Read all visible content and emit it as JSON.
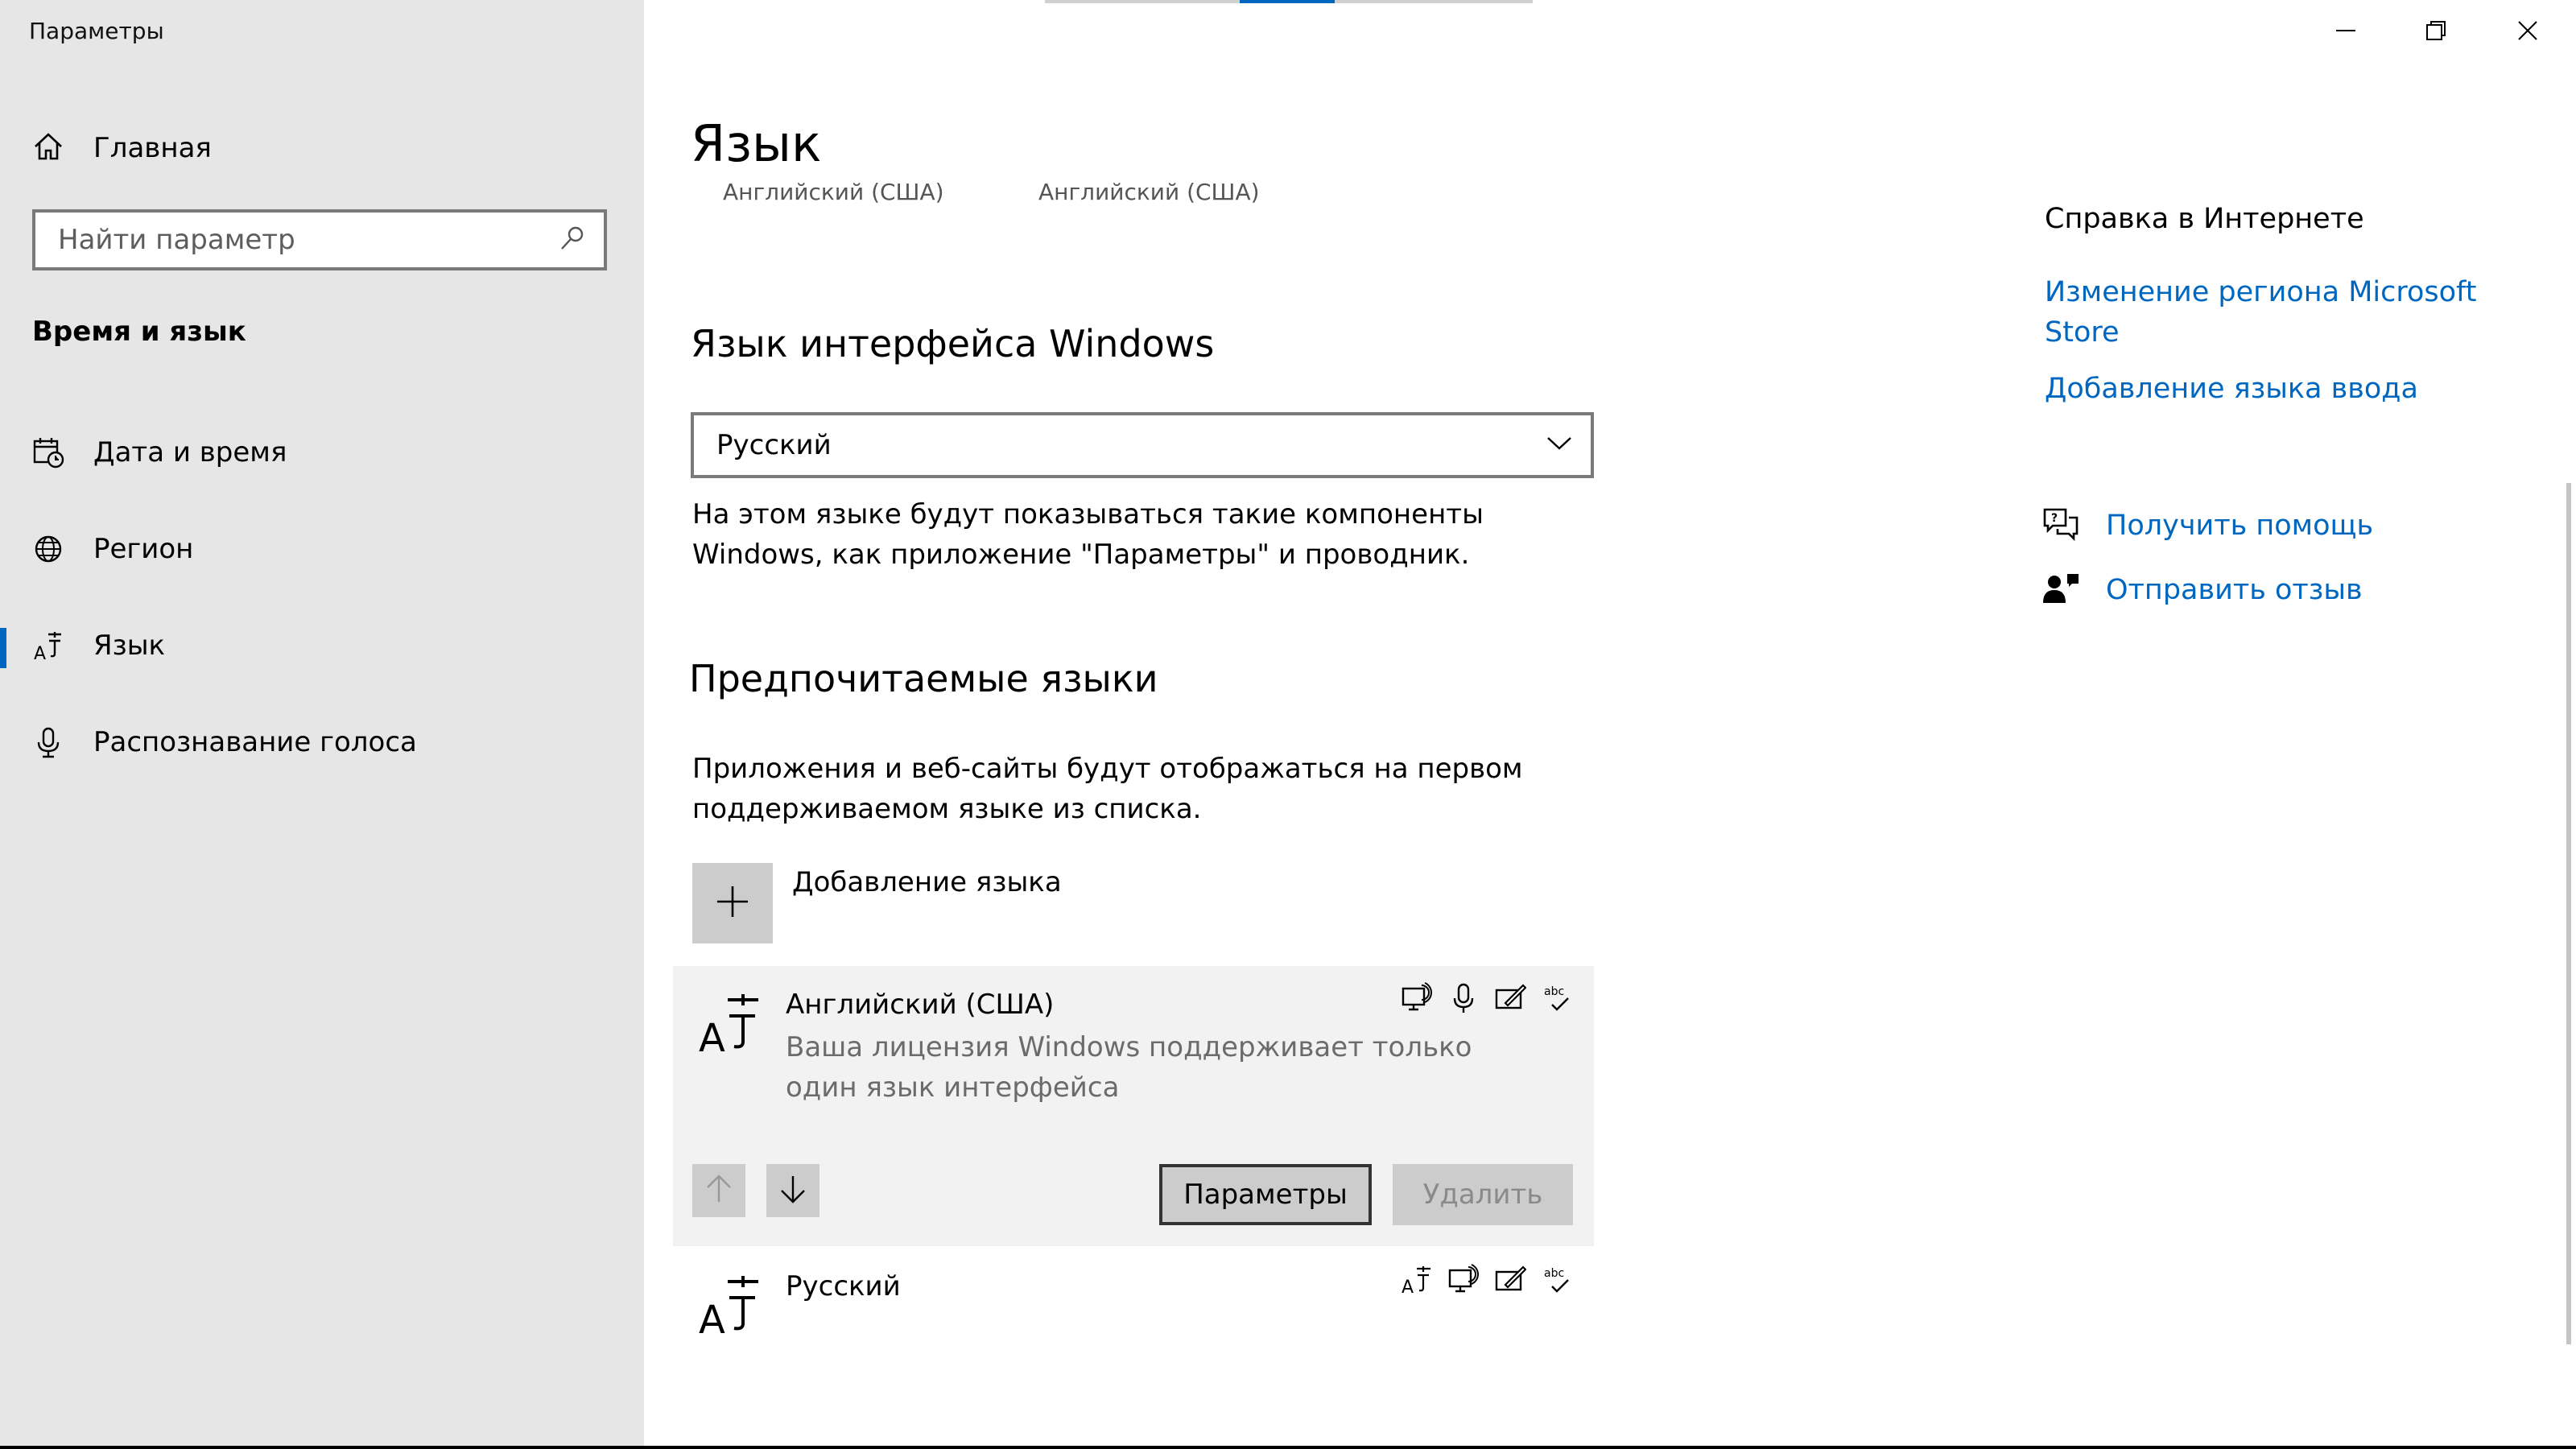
{
  "window": {
    "title": "Параметры"
  },
  "sidebar": {
    "home_label": "Главная",
    "search_placeholder": "Найти параметр",
    "section_title": "Время и язык",
    "items": [
      {
        "label": "Дата и время",
        "icon": "calendar-clock-icon",
        "active": false
      },
      {
        "label": "Регион",
        "icon": "globe-icon",
        "active": false
      },
      {
        "label": "Язык",
        "icon": "language-icon",
        "active": true
      },
      {
        "label": "Распознавание голоса",
        "icon": "microphone-icon",
        "active": false
      }
    ]
  },
  "main": {
    "title": "Язык",
    "clipped_labels": [
      "Английский (США)",
      "Английский (США)"
    ],
    "display_language": {
      "heading": "Язык интерфейса Windows",
      "selected": "Русский",
      "description": "На этом языке будут показываться такие компоненты Windows, как приложение \"Параметры\" и проводник."
    },
    "preferred": {
      "heading": "Предпочитаемые языки",
      "description": "Приложения и веб-сайты будут отображаться на первом поддерживаемом языке из списка.",
      "add_label": "Добавление языка",
      "languages": [
        {
          "name": "Английский (США)",
          "note": "Ваша лицензия Windows поддерживает только один язык интерфейса",
          "features": [
            "speech-display-icon",
            "microphone-icon",
            "handwriting-icon",
            "spellcheck-icon"
          ],
          "options_label": "Параметры",
          "remove_label": "Удалить"
        },
        {
          "name": "Русский",
          "features": [
            "language-pack-icon",
            "speech-display-icon",
            "handwriting-icon",
            "spellcheck-icon"
          ]
        }
      ]
    }
  },
  "help": {
    "heading": "Справка в Интернете",
    "links": [
      "Изменение региона Microsoft Store",
      "Добавление языка ввода"
    ],
    "get_help": "Получить помощь",
    "feedback": "Отправить отзыв"
  },
  "colors": {
    "accent": "#0067c0",
    "sidebar_bg": "#e6e6e6",
    "card_bg": "#f2f2f2"
  }
}
